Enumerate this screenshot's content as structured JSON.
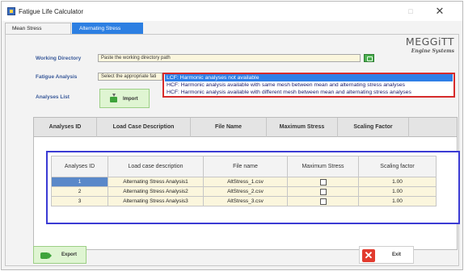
{
  "window": {
    "title": "Fatigue Life Calculator",
    "maximize_glyph": "□",
    "close_glyph": "✕"
  },
  "tabs": [
    {
      "label": "Mean Stress",
      "active": false
    },
    {
      "label": "Alternating Stress",
      "active": true
    }
  ],
  "brand": {
    "name": "MEGGiTT",
    "subtitle": "Engine Systems"
  },
  "form": {
    "working_directory": {
      "label": "Working Directory",
      "value": "Paste the working directory path"
    },
    "fatigue_analysis": {
      "label": "Fatigue Analysis",
      "value": "Select the appropriate fati"
    },
    "analyses_list": {
      "label": "Analyses List"
    }
  },
  "dropdown": {
    "options": [
      "LCF: Harmonic analyses not available",
      "HCF: Harmonic analysis available with same mesh between mean and alternating stress analyses",
      "HCF: Harmonic analysis available with different mesh between mean and alternating stress analyses"
    ],
    "selected_index": 0,
    "highlight_color": "#d62b2b"
  },
  "buttons": {
    "import": "Import",
    "export": "Export",
    "exit": "Exit"
  },
  "outer_table": {
    "columns": [
      "Analyses ID",
      "Load Case Description",
      "File Name",
      "Maximum Stress",
      "Scaling Factor"
    ]
  },
  "inner_table": {
    "columns": [
      "Analyses ID",
      "Load case description",
      "File name",
      "Maximum Stress",
      "Scaling factor"
    ],
    "rows": [
      {
        "id": "1",
        "description": "Alternating Stress Analysis1",
        "file": "AltStress_1.csv",
        "max_stress": false,
        "scaling": "1.00"
      },
      {
        "id": "2",
        "description": "Alternating Stress Analysis2",
        "file": "AltStress_2.csv",
        "max_stress": false,
        "scaling": "1.00"
      },
      {
        "id": "3",
        "description": "Alternating Stress Analysis3",
        "file": "AltStress_3.csv",
        "max_stress": false,
        "scaling": "1.00"
      }
    ],
    "highlight_color": "#3b3bd4"
  },
  "colors": {
    "accent": "#2c7fe2",
    "input_bg": "#fbf6dd",
    "label": "#3a5a9a"
  }
}
